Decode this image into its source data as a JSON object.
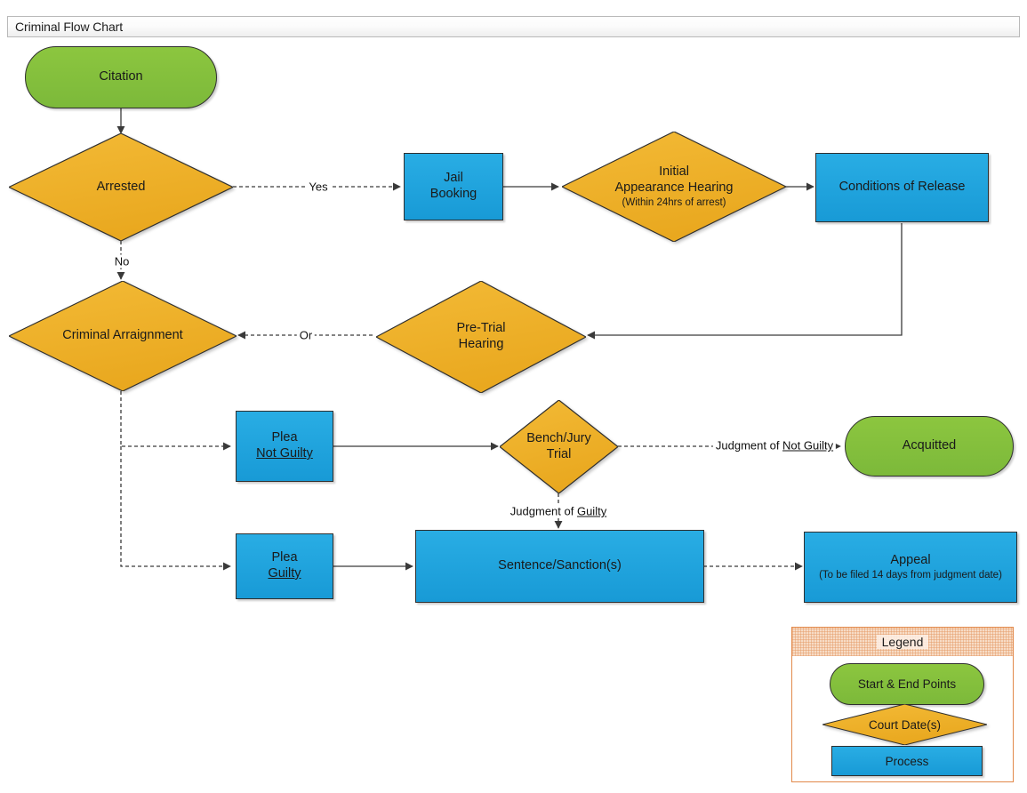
{
  "window": {
    "title": "Criminal Flow Chart"
  },
  "palette": {
    "terminator_green": "#84c341",
    "process_blue": "#1fa3de",
    "decision_orange": "#efb22d",
    "legend_border": "#e2894a",
    "legend_header": "#f7dcc6",
    "connector": "#3a3a3a",
    "outline": "#2f2f2f"
  },
  "nodes": {
    "citation": {
      "label": "Citation",
      "shape": "terminator"
    },
    "arrested": {
      "label": "Arrested",
      "shape": "decision"
    },
    "jail_booking": {
      "line1": "Jail",
      "line2": "Booking",
      "shape": "process"
    },
    "initial_appearance": {
      "line1": "Initial",
      "line2": "Appearance Hearing",
      "sub": "(Within 24hrs of arrest)",
      "shape": "decision"
    },
    "conditions_of_release": {
      "label": "Conditions of Release",
      "shape": "process"
    },
    "criminal_arraignment": {
      "label": "Criminal Arraignment",
      "shape": "decision"
    },
    "pretrial_hearing": {
      "line1": "Pre-Trial",
      "line2": "Hearing",
      "shape": "decision"
    },
    "plea_not_guilty": {
      "line1": "Plea",
      "line2": "Not Guilty",
      "line2_underlined": true,
      "shape": "process"
    },
    "plea_guilty": {
      "line1": "Plea",
      "line2": "Guilty",
      "line2_underlined": true,
      "shape": "process"
    },
    "bench_jury_trial": {
      "line1": "Bench/Jury",
      "line2": "Trial",
      "shape": "decision"
    },
    "acquitted": {
      "label": "Acquitted",
      "shape": "terminator"
    },
    "sentence": {
      "label": "Sentence/Sanction(s)",
      "shape": "process"
    },
    "appeal": {
      "label": "Appeal",
      "sub": "(To be filed 14 days from judgment date)",
      "shape": "process"
    }
  },
  "edge_labels": {
    "yes": "Yes",
    "no": "No",
    "or": "Or",
    "judgment_not_guilty_prefix": "Judgment of ",
    "judgment_not_guilty_value": "Not Guilty",
    "judgment_guilty_prefix": "Judgment of ",
    "judgment_guilty_value": "Guilty"
  },
  "legend": {
    "title": "Legend",
    "items": [
      {
        "label": "Start & End Points",
        "shape": "terminator"
      },
      {
        "label": "Court Date(s)",
        "shape": "decision"
      },
      {
        "label": "Process",
        "shape": "process"
      }
    ]
  }
}
